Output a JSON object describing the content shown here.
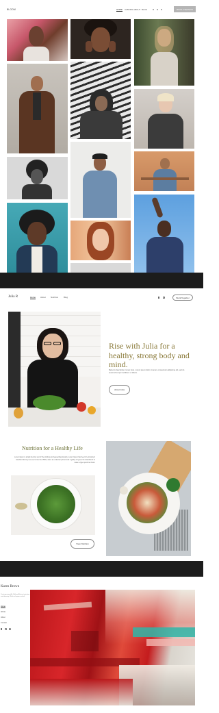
{
  "colors": {
    "divider": "#1c1c1c",
    "gold_heading": "#8a7a3a",
    "green_heading": "#6b7035"
  },
  "gallery": {
    "brand": "BLOOM",
    "nav": [
      "HOME",
      "ALBUMS",
      "ABOUT",
      "BLOG"
    ],
    "social_icons": [
      "facebook-icon",
      "twitter-icon",
      "instagram-icon"
    ],
    "cta_label": "BOOK A SESSION"
  },
  "julia": {
    "brand": "Julia R",
    "nav": [
      "Home",
      "About",
      "Nutrition",
      "Blog"
    ],
    "cta_label": "Work Together",
    "hero_heading": "Rise with Julia for a healthy, strong body and mind.",
    "hero_body": "Below is description comes here. Lorem ipsum dolor sit amet, consectetur adipiscing elit, sed do eiusmod tempor incididunt ut labore.",
    "hero_button": "About Julia",
    "section_heading": "Nutrition for a Healthy Life",
    "section_body": "Lorem ipsum is simply dummy text of the printing and typesetting industry. Lorem Ipsum has been the industry's standard dummy text ever since the 1500s, when an unknown printer took a galley of type and scrambled it to make a type specimen book.",
    "section_button": "View Nutrition"
  },
  "karen": {
    "name": "Karen Brown",
    "bio": "Contemporary Art Gallery. Abstract painting and drawing. Works of paper and oil.",
    "nav": [
      "Home",
      "Works",
      "About",
      "Contact"
    ]
  }
}
